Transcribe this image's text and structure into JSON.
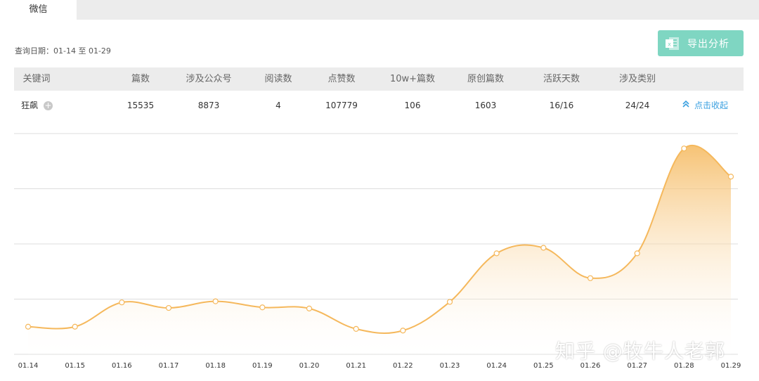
{
  "tab": {
    "label": "微信"
  },
  "query": {
    "date_range": "查询日期：01-14 至 01-29"
  },
  "export": {
    "label": "导出分析"
  },
  "table": {
    "headers": [
      "关键词",
      "篇数",
      "涉及公众号",
      "阅读数",
      "点赞数",
      "10w+篇数",
      "原创篇数",
      "活跃天数",
      "涉及类别"
    ],
    "row": {
      "keyword": "狂飙",
      "articles": "15535",
      "accounts": "8873",
      "reads": "4",
      "likes": "107779",
      "over_100k": "106",
      "original": "1603",
      "active_days": "16/16",
      "categories": "24/24"
    },
    "collapse_label": "点击收起"
  },
  "chart_data": {
    "type": "area",
    "x": [
      "01.14",
      "01.15",
      "01.16",
      "01.17",
      "01.18",
      "01.19",
      "01.20",
      "01.21",
      "01.22",
      "01.23",
      "01.24",
      "01.25",
      "01.26",
      "01.27",
      "01.28",
      "01.29"
    ],
    "series": [
      {
        "values": [
          500,
          500,
          940,
          840,
          960,
          850,
          830,
          460,
          430,
          950,
          1830,
          1930,
          1380,
          1830,
          3730,
          3220
        ]
      }
    ],
    "ylim": [
      0,
      4000
    ],
    "grid": true,
    "color": "#f5b85c"
  },
  "watermark": "知乎 @牧牛人老郭"
}
